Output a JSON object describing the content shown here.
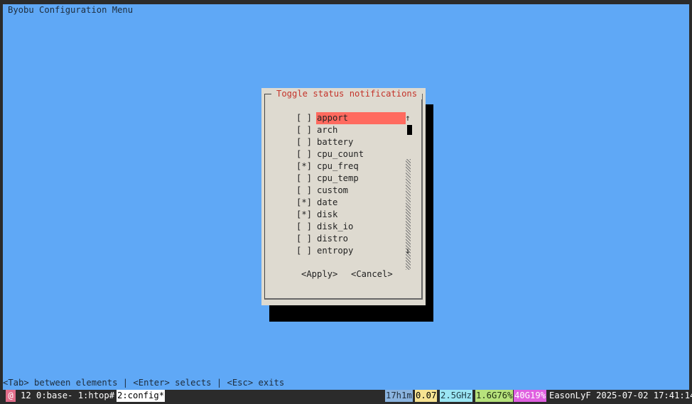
{
  "app": {
    "title": "Byobu Configuration Menu",
    "help": "<Tab> between elements | <Enter> selects | <Esc> exits"
  },
  "dialog": {
    "title": "Toggle status notifications",
    "items": [
      {
        "check": "[ ]",
        "label": "apport",
        "selected": true
      },
      {
        "check": "[ ]",
        "label": "arch"
      },
      {
        "check": "[ ]",
        "label": "battery"
      },
      {
        "check": "[ ]",
        "label": "cpu_count"
      },
      {
        "check": "[*]",
        "label": "cpu_freq"
      },
      {
        "check": "[ ]",
        "label": "cpu_temp"
      },
      {
        "check": "[ ]",
        "label": "custom"
      },
      {
        "check": "[*]",
        "label": "date"
      },
      {
        "check": "[*]",
        "label": "disk"
      },
      {
        "check": "[ ]",
        "label": "disk_io"
      },
      {
        "check": "[ ]",
        "label": "distro"
      },
      {
        "check": "[ ]",
        "label": "entropy"
      }
    ],
    "scroll_up": "↑",
    "scroll_down": "↓",
    "apply_label": "<Apply>",
    "cancel_label": "<Cancel>"
  },
  "status_bar": {
    "logo": "@",
    "windows": "12 0:base- 1:htop#",
    "current_window": "2:config*",
    "uptime": "17h1m",
    "load": "0.07",
    "cpu_freq": "2.5GHz",
    "memory": "1.6G76%",
    "disk": "40G19%",
    "host_time": "EasonLyF 2025-07-02 17:41:14"
  }
}
